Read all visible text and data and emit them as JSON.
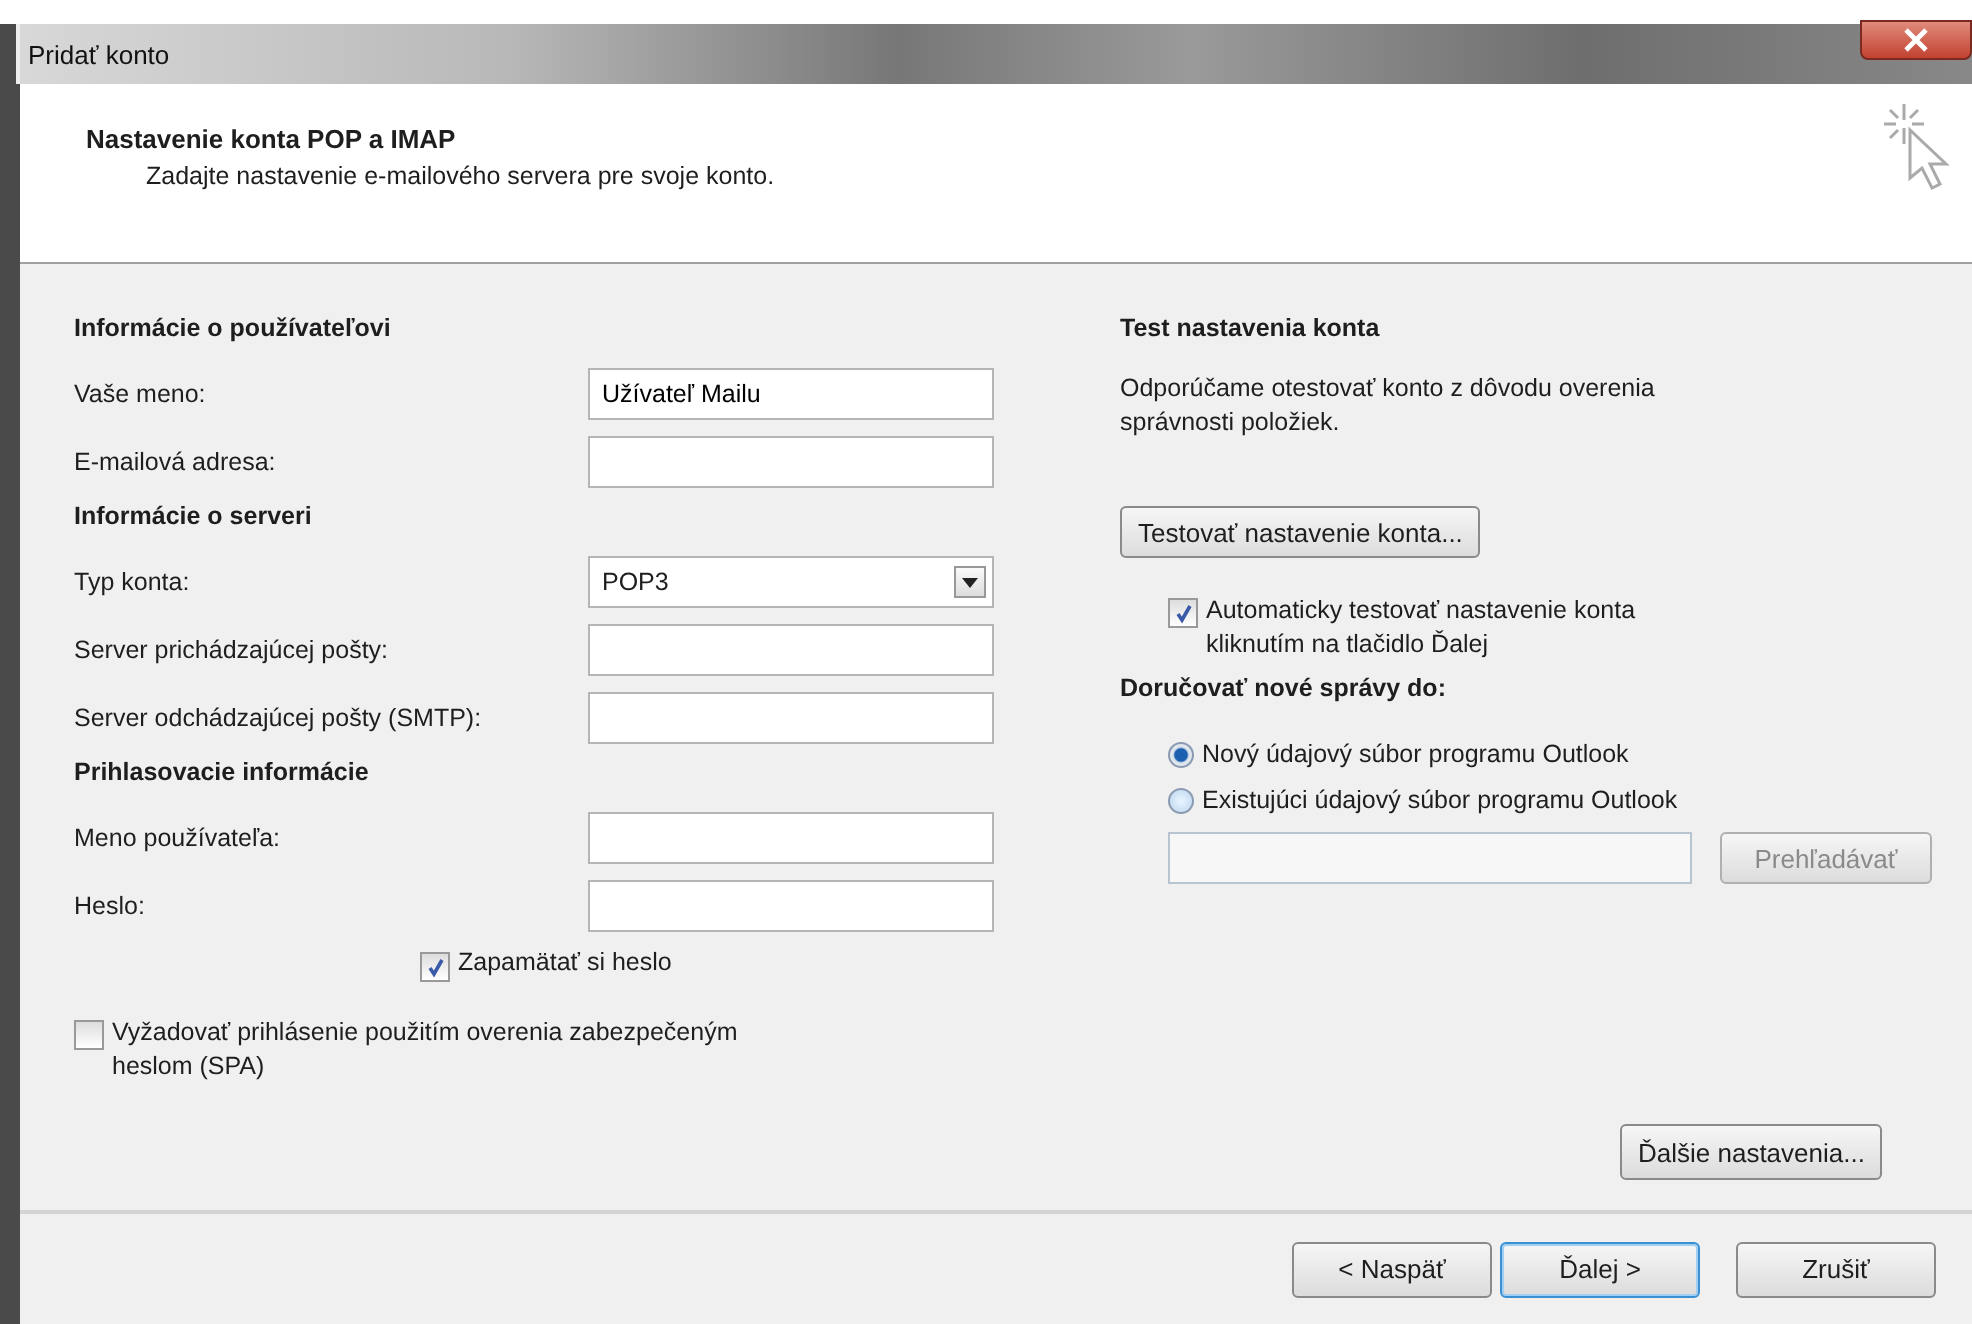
{
  "window": {
    "title": "Pridať konto"
  },
  "header": {
    "title": "Nastavenie konta POP a IMAP",
    "subtitle": "Zadajte nastavenie e-mailového servera pre svoje konto."
  },
  "sections": [
    {
      "heading": "Informácie o používateľovi",
      "fields": [
        {
          "kind": "text",
          "label": "Vaše meno:",
          "value": "Užívateľ Mailu"
        },
        {
          "kind": "text",
          "label": "E-mailová adresa:"
        }
      ]
    },
    {
      "heading": "Informácie o serveri",
      "fields": [
        {
          "kind": "select",
          "label": "Typ konta:",
          "value": "POP3"
        },
        {
          "kind": "text",
          "label": "Server prichádzajúcej pošty:"
        },
        {
          "kind": "text",
          "label": "Server odchádzajúcej pošty (SMTP):"
        }
      ]
    },
    {
      "heading": "Prihlasovacie informácie",
      "fields": [
        {
          "kind": "text",
          "label": "Meno používateľa:"
        },
        {
          "kind": "text",
          "label": "Heslo:"
        }
      ]
    }
  ],
  "remember_password": {
    "label": "Zapamätať si heslo",
    "checked": true
  },
  "require_spa": {
    "label": "Vyžadovať prihlásenie použitím overenia zabezpečeným heslom (SPA)",
    "checked": false
  },
  "test": {
    "heading": "Test nastavenia konta",
    "description": "Odporúčame otestovať konto z dôvodu overenia správnosti položiek.",
    "button": "Testovať nastavenie konta...",
    "auto_test": {
      "label": "Automaticky testovať nastavenie konta kliknutím na tlačidlo Ďalej",
      "checked": true
    }
  },
  "deliver": {
    "heading": "Doručovať nové správy do:",
    "options": [
      {
        "label": "Nový údajový súbor programu Outlook",
        "selected": true
      },
      {
        "label": "Existujúci údajový súbor programu Outlook",
        "selected": false
      }
    ],
    "browse": {
      "label": "Prehľadávať",
      "disabled": true
    }
  },
  "more_settings": "Ďalšie nastavenia...",
  "footer_buttons": [
    {
      "label": "< Naspäť",
      "default": false
    },
    {
      "label": "Ďalej >",
      "default": true
    },
    {
      "label": "Zrušiť",
      "default": false
    }
  ]
}
